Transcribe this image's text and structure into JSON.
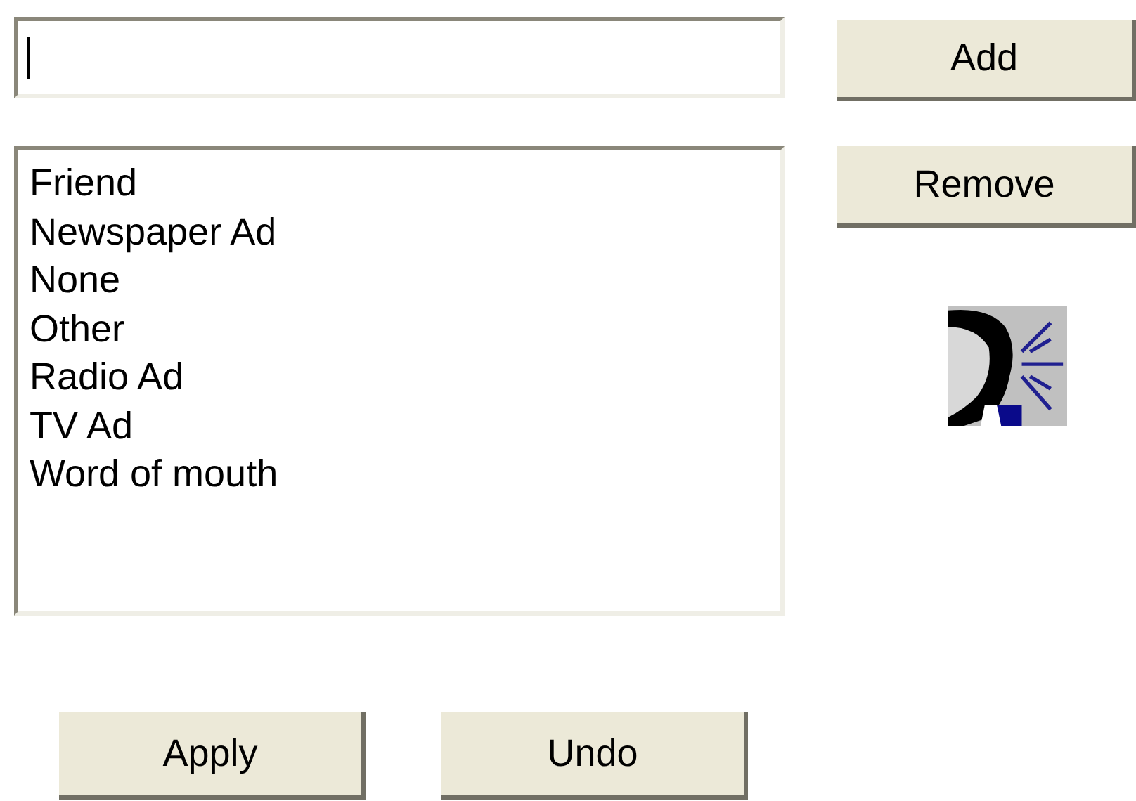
{
  "entry_field": {
    "focused": true
  },
  "side_buttons": [
    "Add",
    "Remove"
  ],
  "list_items": [
    {
      "label": "Friend"
    },
    {
      "label": "Newspaper Ad"
    },
    {
      "label": "None"
    },
    {
      "label": "Other"
    },
    {
      "label": "Radio Ad"
    },
    {
      "label": "TV Ad"
    },
    {
      "label": "Word of mouth"
    }
  ],
  "bottom_buttons": [
    "Apply",
    "Undo"
  ]
}
